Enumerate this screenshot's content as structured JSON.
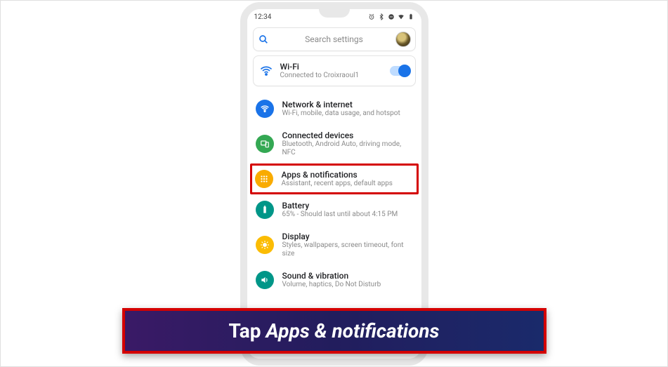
{
  "statusbar": {
    "time": "12:34"
  },
  "search": {
    "placeholder": "Search settings"
  },
  "wifi": {
    "title": "Wi-Fi",
    "subtitle": "Connected to Croixraoul1",
    "enabled": true
  },
  "settings": [
    {
      "id": "network",
      "title": "Network & internet",
      "subtitle": "Wi-Fi, mobile, data usage, and hotspot",
      "color": "#1a73e8",
      "icon": "wifi"
    },
    {
      "id": "devices",
      "title": "Connected devices",
      "subtitle": "Bluetooth, Android Auto, driving mode, NFC",
      "color": "#34a853",
      "icon": "devices"
    },
    {
      "id": "apps",
      "title": "Apps & notifications",
      "subtitle": "Assistant, recent apps, default apps",
      "color": "#f9ab00",
      "icon": "apps",
      "highlight": true
    },
    {
      "id": "battery",
      "title": "Battery",
      "subtitle": "65% - Should last until about 4:15 PM",
      "color": "#009688",
      "icon": "battery"
    },
    {
      "id": "display",
      "title": "Display",
      "subtitle": "Styles, wallpapers, screen timeout, font size",
      "color": "#fbbc04",
      "icon": "display"
    },
    {
      "id": "sound",
      "title": "Sound & vibration",
      "subtitle": "Volume, haptics, Do Not Disturb",
      "color": "#009688",
      "icon": "sound"
    }
  ],
  "caption": {
    "prefix": "Tap ",
    "emph": "Apps & notifications"
  }
}
